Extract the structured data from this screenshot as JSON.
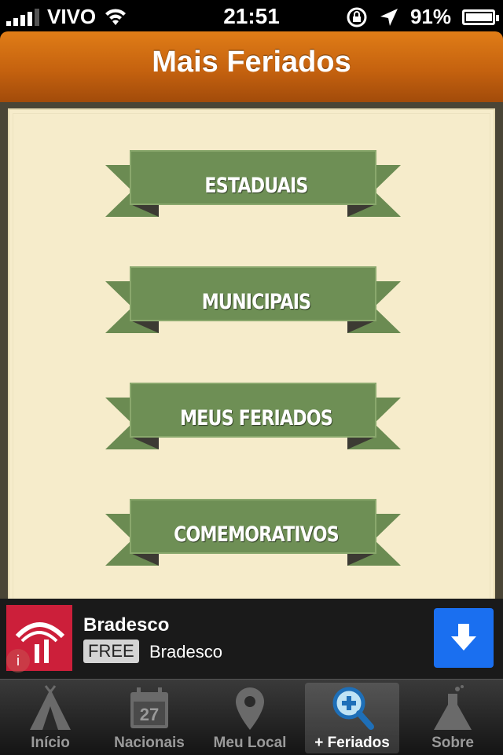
{
  "status_bar": {
    "carrier": "VIVO",
    "time": "21:51",
    "battery": "91%",
    "battery_level": 0.91
  },
  "nav": {
    "title": "Mais Feriados"
  },
  "colors": {
    "ribbon": "#6b8b52",
    "ribbon_dark": "#4a6236",
    "nav": "#c5620f",
    "paper": "#f6eccb",
    "ad_button": "#1a6ff0"
  },
  "ribbons": [
    {
      "label": "ESTADUAIS"
    },
    {
      "label": "MUNICIPAIS"
    },
    {
      "label": "MEUS FERIADOS"
    },
    {
      "label": "COMEMORATIVOS"
    }
  ],
  "ad": {
    "name": "Bradesco",
    "badge": "FREE",
    "subtitle": "Bradesco",
    "download_icon": "down-arrow-icon",
    "info_icon": "info-icon"
  },
  "tabs": [
    {
      "label": "Início",
      "icon": "tent-icon"
    },
    {
      "label": "Nacionais",
      "icon": "calendar-icon",
      "icon_text": "27"
    },
    {
      "label": "Meu Local",
      "icon": "location-pin-icon"
    },
    {
      "label": "+ Feriados",
      "icon": "magnifier-plus-icon",
      "active": true
    },
    {
      "label": "Sobre",
      "icon": "flask-icon"
    }
  ]
}
